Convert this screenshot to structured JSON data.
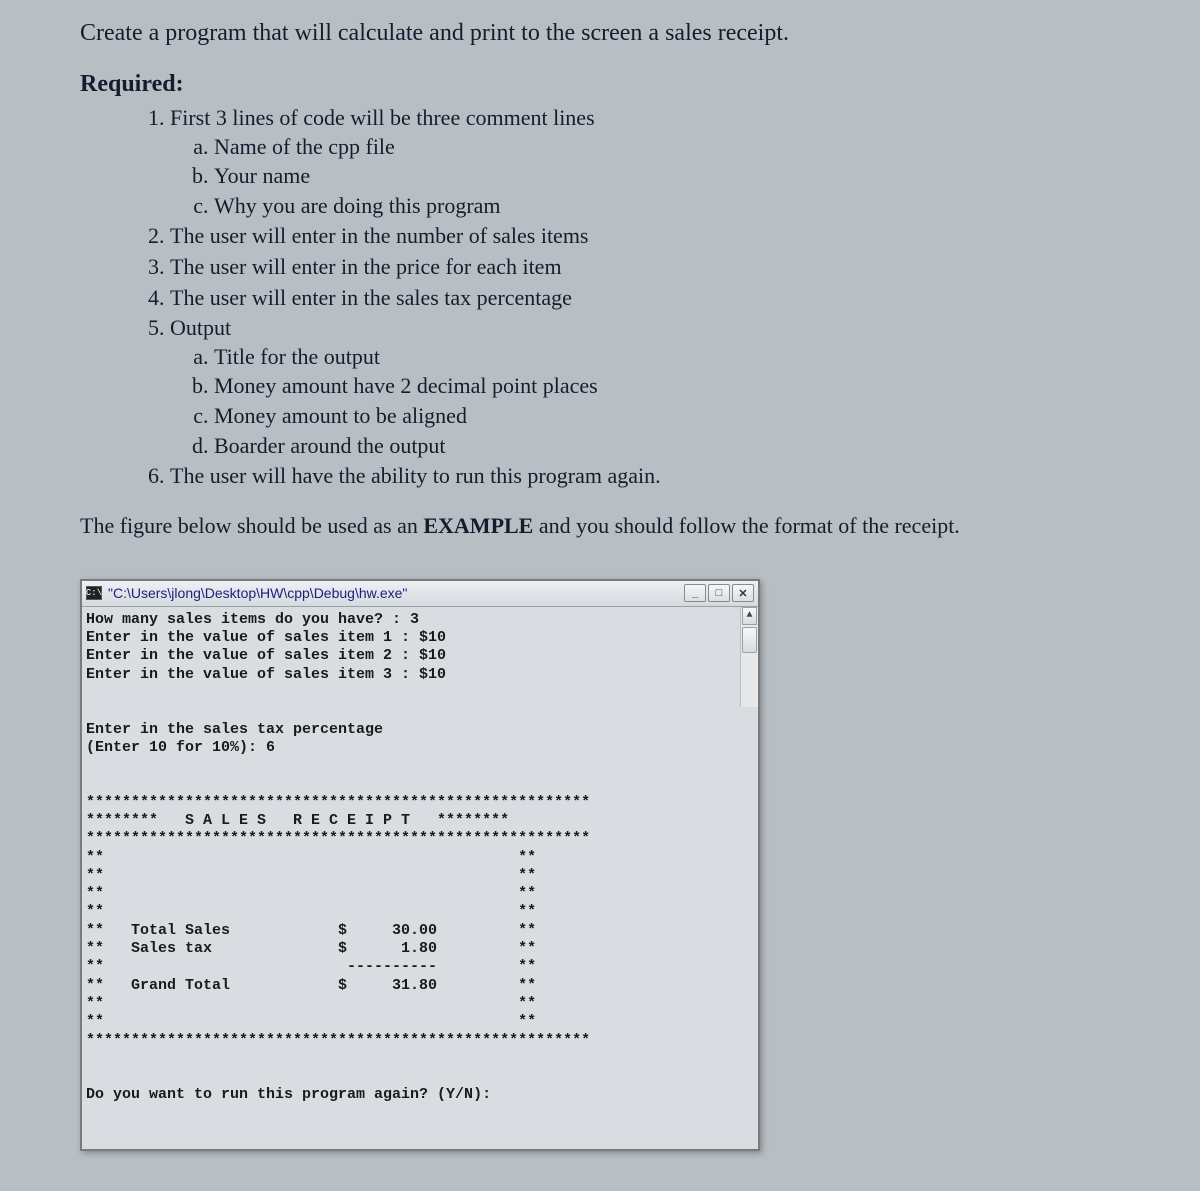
{
  "intro": "Create a program that will calculate and print to the screen a sales receipt.",
  "required_heading": "Required:",
  "list": {
    "item1": "First 3 lines of code will be three comment lines",
    "item1_sub": {
      "a": "Name of the cpp file",
      "b": "Your name",
      "c": "Why you are doing this program"
    },
    "item2": "The user will enter in the number of sales items",
    "item3": "The user will enter in the price for each item",
    "item4": "The user will enter in the sales tax percentage",
    "item5": "Output",
    "item5_sub": {
      "a": "Title for the output",
      "b": "Money amount have 2 decimal point places",
      "c": "Money amount to be aligned",
      "d": "Boarder around the output"
    },
    "item6": "The user will have the ability to run this program again."
  },
  "figure_note_pre": "The figure below should be used as an ",
  "figure_note_bold": "EXAMPLE",
  "figure_note_post": " and you should follow the format of the receipt.",
  "console": {
    "title": "\"C:\\Users\\jlong\\Desktop\\HW\\cpp\\Debug\\hw.exe\"",
    "icon_label": "C:\\",
    "buttons": {
      "min": "_",
      "max": "□",
      "close": "✕"
    },
    "lines": [
      "How many sales items do you have? : 3",
      "Enter in the value of sales item 1 : $10",
      "Enter in the value of sales item 2 : $10",
      "Enter in the value of sales item 3 : $10",
      "",
      "",
      "Enter in the sales tax percentage",
      "(Enter 10 for 10%): 6",
      "",
      "",
      "********************************************************",
      "********   S A L E S   R E C E I P T   ********",
      "********************************************************",
      "**                                              **",
      "**                                              **",
      "**                                              **",
      "**                                              **",
      "**   Total Sales            $     30.00         **",
      "**   Sales tax              $      1.80         **",
      "**                           ----------         **",
      "**   Grand Total            $     31.80         **",
      "**                                              **",
      "**                                              **",
      "********************************************************",
      "",
      "",
      "Do you want to run this program again? (Y/N):"
    ]
  }
}
